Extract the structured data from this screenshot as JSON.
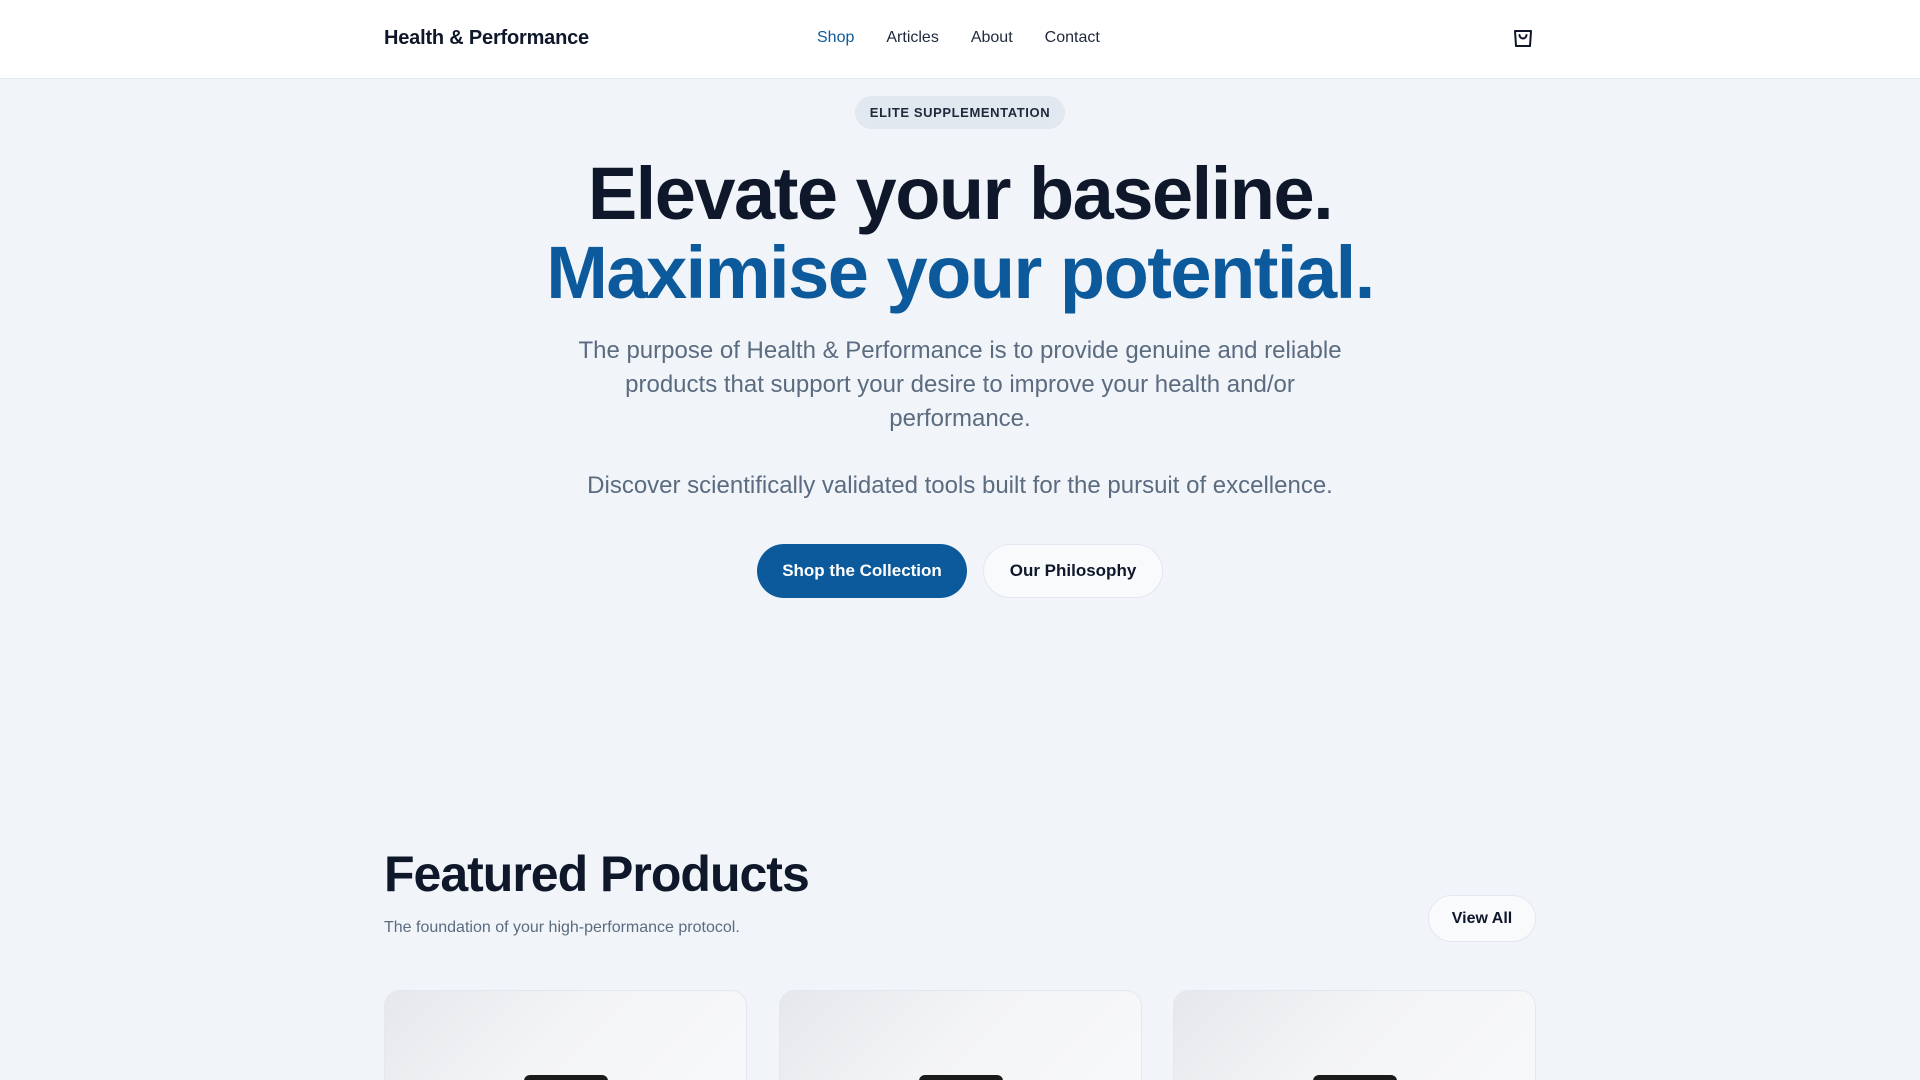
{
  "header": {
    "brand": "Health & Performance",
    "nav": [
      {
        "label": "Shop",
        "active": true
      },
      {
        "label": "Articles",
        "active": false
      },
      {
        "label": "About",
        "active": false
      },
      {
        "label": "Contact",
        "active": false
      }
    ],
    "cart_icon": "shopping-bag-icon"
  },
  "hero": {
    "badge": "ELITE SUPPLEMENTATION",
    "title_line1": "Elevate your baseline.",
    "title_line2": "Maximise your potential.",
    "lead": "The purpose of Health & Performance is to provide genuine and reliable products that support your desire to improve your health and/or performance.",
    "lead2": "Discover scientifically validated tools built for the pursuit of excellence.",
    "primary_button": "Shop the Collection",
    "secondary_button": "Our Philosophy"
  },
  "featured": {
    "title": "Featured Products",
    "subtitle": "The foundation of your high-performance protocol.",
    "view_all": "View All",
    "products": [
      {},
      {},
      {}
    ]
  },
  "colors": {
    "accent": "#0c5a9b",
    "background": "#f1f5f9",
    "text": "#0f172a",
    "muted": "#5b6b80"
  }
}
